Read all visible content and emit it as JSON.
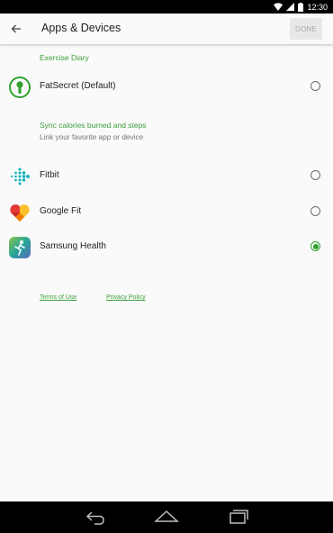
{
  "status": {
    "time": "12:30"
  },
  "app_bar": {
    "title": "Apps & Devices",
    "done_label": "DONE"
  },
  "exercise_diary": {
    "header": "Exercise Diary",
    "item": {
      "label": "FatSecret (Default)",
      "selected": false
    }
  },
  "sync": {
    "header": "Sync calories burned and steps",
    "subtitle": "Link your favorite app or device",
    "items": [
      {
        "label": "Fitbit",
        "icon": "fitbit-icon",
        "selected": false
      },
      {
        "label": "Google Fit",
        "icon": "google-fit-icon",
        "selected": false
      },
      {
        "label": "Samsung Health",
        "icon": "samsung-health-icon",
        "selected": true
      }
    ]
  },
  "links": {
    "terms": "Terms of Use",
    "privacy": "Privacy Policy"
  },
  "colors": {
    "accent": "#2fa12f",
    "background": "#fafafa",
    "done_disabled": "#e8e8e8"
  }
}
